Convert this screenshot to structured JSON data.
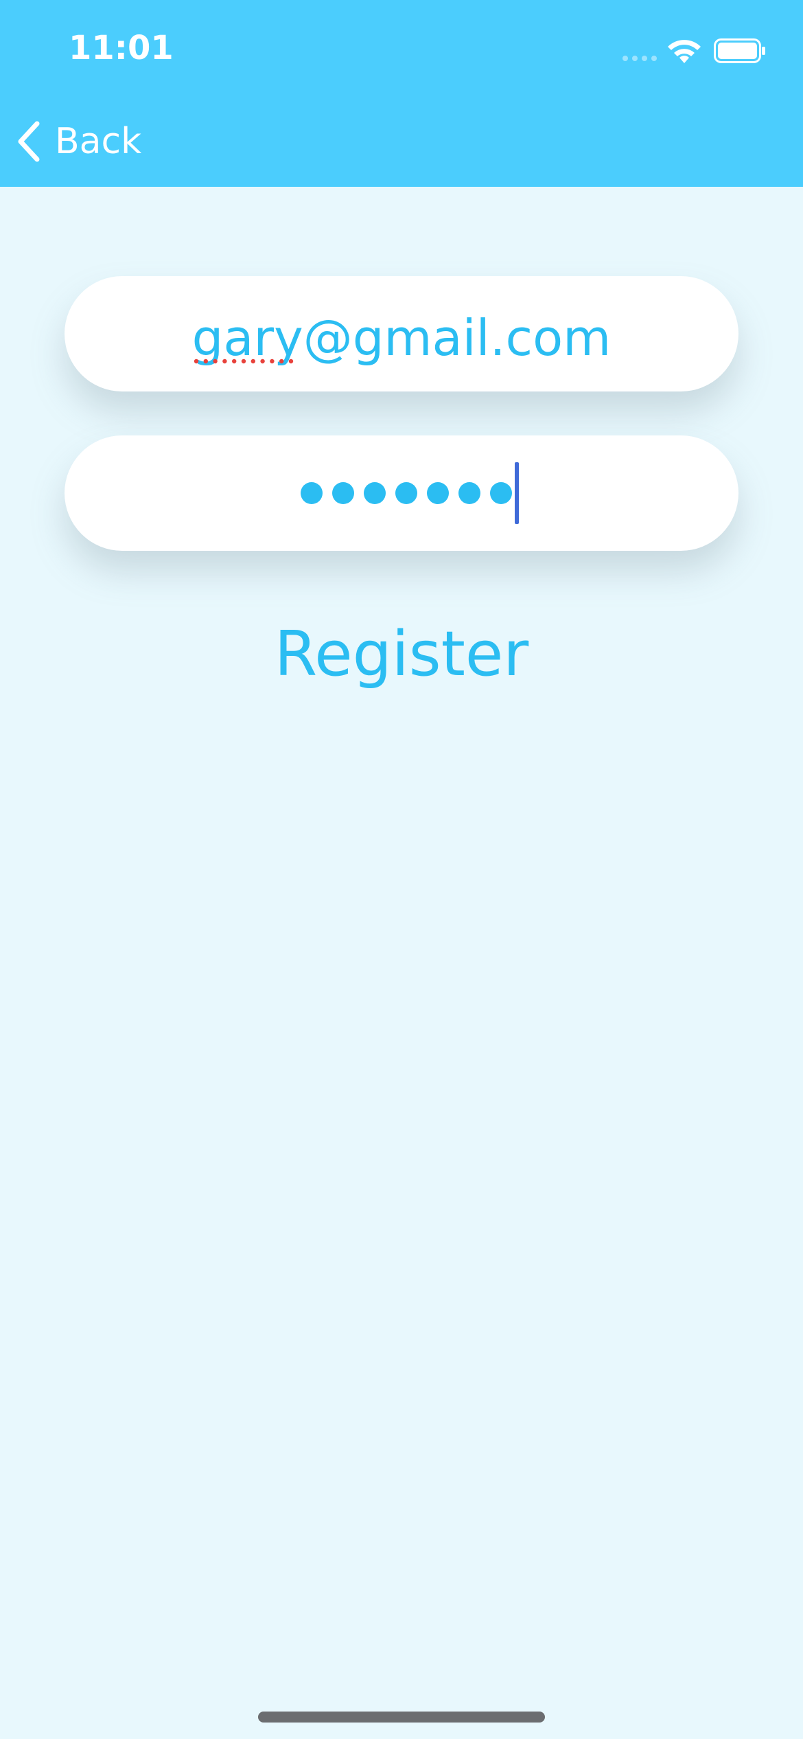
{
  "status_bar": {
    "time": "11:01",
    "wifi_icon": "wifi-icon",
    "battery_icon": "battery-icon"
  },
  "nav": {
    "back_label": "Back",
    "back_icon": "chevron-left-icon"
  },
  "form": {
    "email_value": "gary@gmail.com",
    "password_mask_count": 7,
    "register_label": "Register"
  },
  "colors": {
    "header": "#4bcdfd",
    "background": "#e8f8fd",
    "accent": "#2bbdf2",
    "caret": "#3f6ad8"
  }
}
